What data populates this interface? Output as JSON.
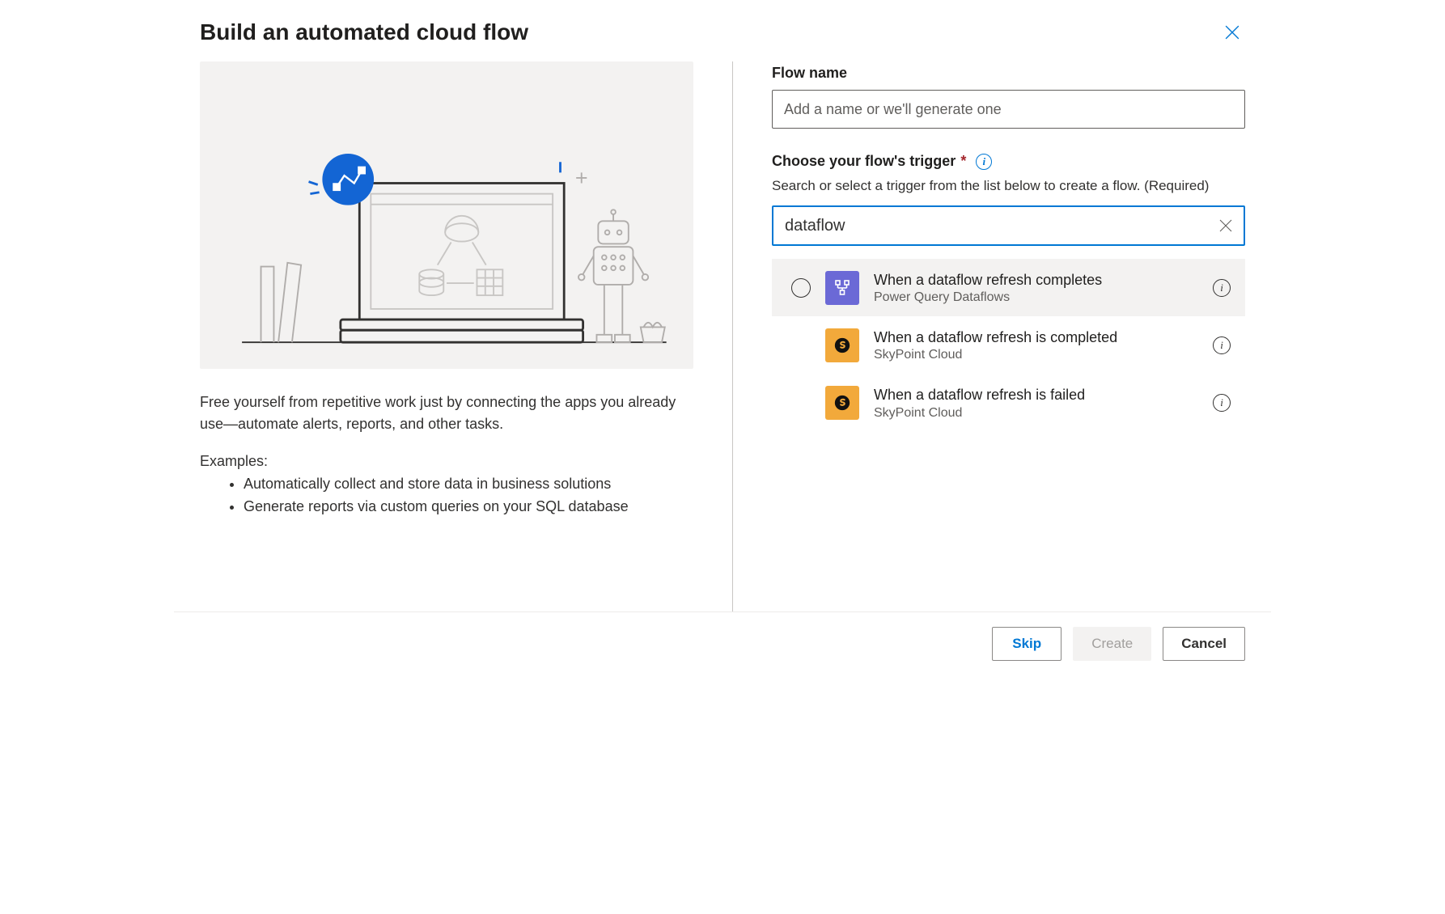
{
  "header": {
    "title": "Build an automated cloud flow"
  },
  "left": {
    "description": "Free yourself from repetitive work just by connecting the apps you already use—automate alerts, reports, and other tasks.",
    "examples_label": "Examples:",
    "examples": [
      "Automatically collect and store data in business solutions",
      "Generate reports via custom queries on your SQL database"
    ]
  },
  "right": {
    "flow_name_label": "Flow name",
    "flow_name_placeholder": "Add a name or we'll generate one",
    "flow_name_value": "",
    "trigger_label": "Choose your flow's trigger",
    "trigger_helper": "Search or select a trigger from the list below to create a flow. (Required)",
    "search_value": "dataflow",
    "triggers": [
      {
        "title": "When a dataflow refresh completes",
        "connector": "Power Query Dataflows",
        "icon": "purple",
        "selected": true
      },
      {
        "title": "When a dataflow refresh is completed",
        "connector": "SkyPoint Cloud",
        "icon": "orange",
        "selected": false
      },
      {
        "title": "When a dataflow refresh is failed",
        "connector": "SkyPoint Cloud",
        "icon": "orange",
        "selected": false
      }
    ]
  },
  "footer": {
    "skip": "Skip",
    "create": "Create",
    "cancel": "Cancel"
  }
}
